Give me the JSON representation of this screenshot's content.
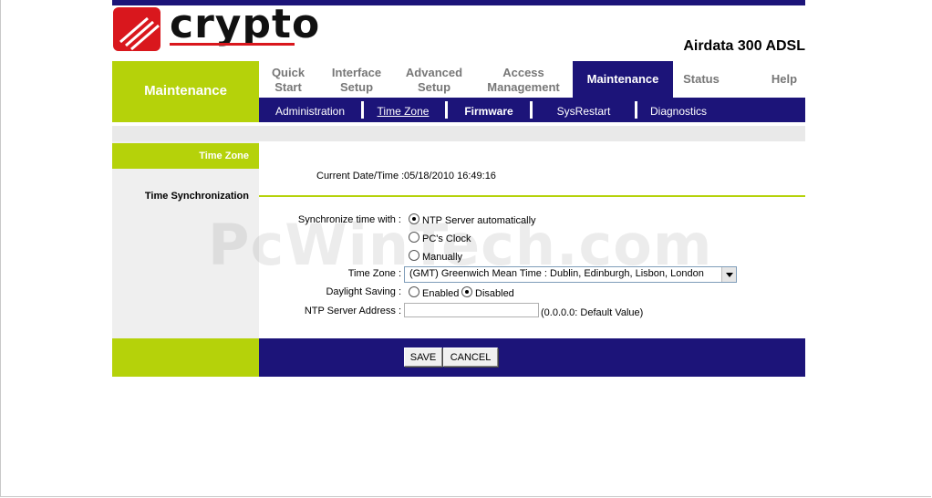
{
  "brand": {
    "logo_text": "crypto",
    "model": "Airdata 300 ADSL"
  },
  "section_title": "Maintenance",
  "menu": {
    "items": [
      {
        "line1": "Quick",
        "line2": "Start"
      },
      {
        "line1": "Interface",
        "line2": "Setup"
      },
      {
        "line1": "Advanced",
        "line2": "Setup"
      },
      {
        "line1": "Access",
        "line2": "Management"
      },
      {
        "line1": "Maintenance",
        "line2": ""
      },
      {
        "line1": "Status",
        "line2": ""
      },
      {
        "line1": "Help",
        "line2": ""
      }
    ],
    "active": "Maintenance"
  },
  "submenu": {
    "items": [
      "Administration",
      "Time Zone",
      "Firmware",
      "SysRestart",
      "Diagnostics"
    ],
    "current": "Time Zone"
  },
  "sidebar": {
    "tab": "Time Zone",
    "section": "Time Synchronization"
  },
  "current_datetime": {
    "label": "Current Date/Time :",
    "value": "05/18/2010 16:49:16"
  },
  "sync": {
    "label": "Synchronize time with :",
    "options": [
      "NTP Server automatically",
      "PC's Clock",
      "Manually"
    ],
    "selected": "NTP Server automatically"
  },
  "timezone": {
    "label": "Time Zone :",
    "value": "(GMT) Greenwich Mean Time : Dublin, Edinburgh, Lisbon, London"
  },
  "daylight": {
    "label": "Daylight Saving :",
    "options": [
      "Enabled",
      "Disabled"
    ],
    "selected": "Disabled"
  },
  "ntp": {
    "label": "NTP Server Address :",
    "value": "",
    "hint": "(0.0.0.0: Default Value)"
  },
  "buttons": {
    "save": "SAVE",
    "cancel": "CANCEL"
  },
  "watermark": "PcWinTech.com",
  "colors": {
    "navy": "#1c1479",
    "green": "#b5d20a",
    "logo_red": "#d9171d"
  }
}
